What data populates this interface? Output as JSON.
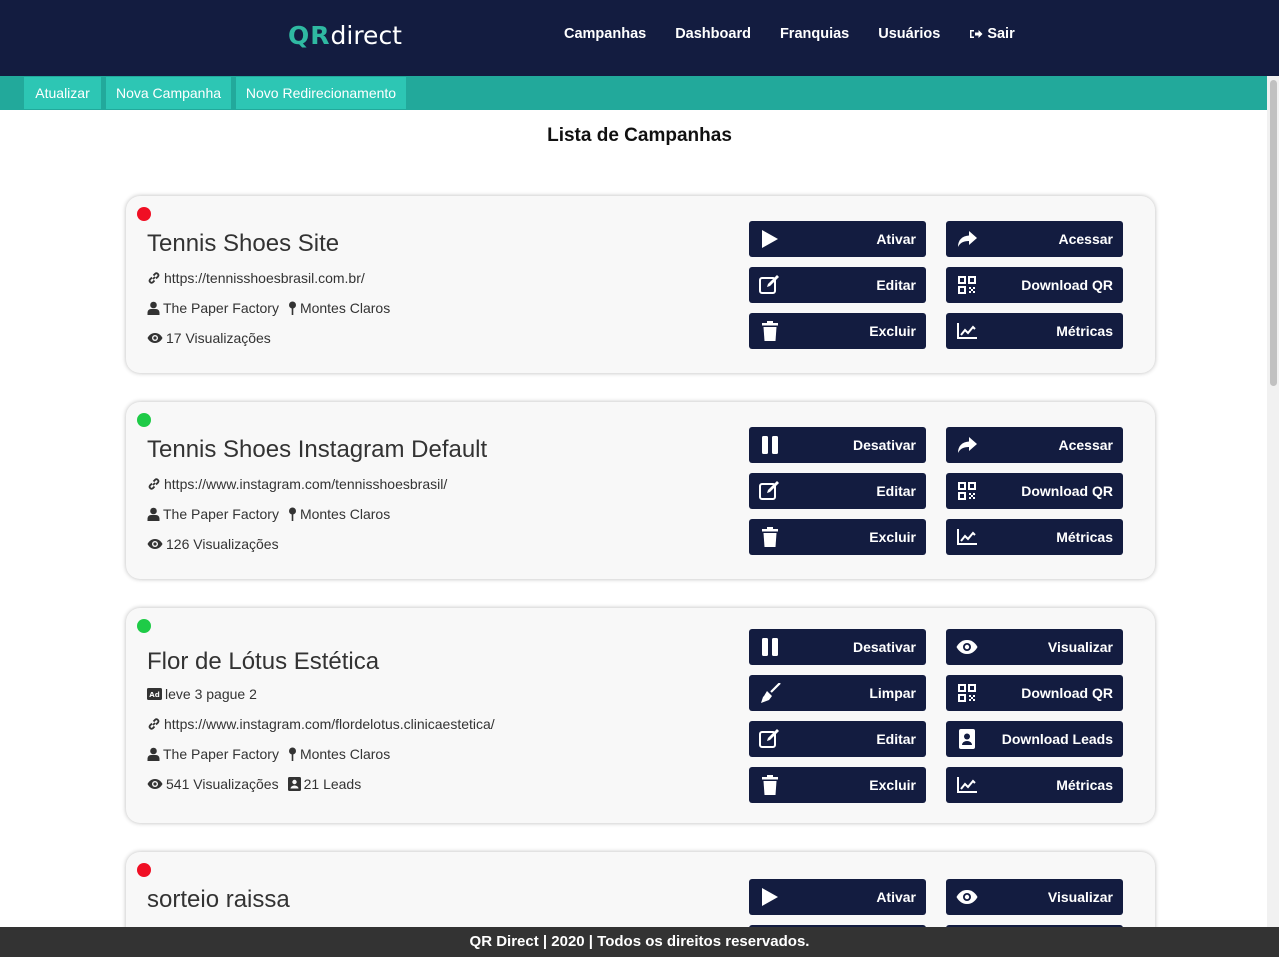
{
  "brand": {
    "logo_qr": "QR",
    "logo_direct": "direct"
  },
  "nav": [
    {
      "label": "Campanhas"
    },
    {
      "label": "Dashboard"
    },
    {
      "label": "Franquias"
    },
    {
      "label": "Usuários"
    },
    {
      "label": "Sair",
      "icon": "sign-out-icon"
    }
  ],
  "toolbar": [
    {
      "label": "Atualizar"
    },
    {
      "label": "Nova Campanha"
    },
    {
      "label": "Novo Redirecionamento"
    }
  ],
  "page_title": "Lista de Campanhas",
  "campaigns": [
    {
      "status": "inactive",
      "status_color": "#f00f24",
      "title": "Tennis Shoes Site",
      "url": "https://tennisshoesbrasil.com.br/",
      "company": "The Paper Factory",
      "city": "Montes Claros",
      "views": "17 Visualizações",
      "buttons": {
        "toggle": "Ativar",
        "access": "Acessar",
        "edit": "Editar",
        "download_qr": "Download QR",
        "delete": "Excluir",
        "metrics": "Métricas"
      }
    },
    {
      "status": "active",
      "status_color": "#1ecb47",
      "title": "Tennis Shoes Instagram Default",
      "url": "https://www.instagram.com/tennisshoesbrasil/",
      "company": "The Paper Factory",
      "city": "Montes Claros",
      "views": "126 Visualizações",
      "buttons": {
        "toggle": "Desativar",
        "access": "Acessar",
        "edit": "Editar",
        "download_qr": "Download QR",
        "delete": "Excluir",
        "metrics": "Métricas"
      }
    },
    {
      "status": "active",
      "status_color": "#1ecb47",
      "title": "Flor de Lótus Estética",
      "promo": "leve 3 pague 2",
      "url": "https://www.instagram.com/flordelotus.clinicaestetica/",
      "company": "The Paper Factory",
      "city": "Montes Claros",
      "views": "541 Visualizações",
      "leads": "21 Leads",
      "buttons": {
        "toggle": "Desativar",
        "view": "Visualizar",
        "clean": "Limpar",
        "download_qr": "Download QR",
        "edit": "Editar",
        "download_leads": "Download Leads",
        "delete": "Excluir",
        "metrics": "Métricas"
      }
    },
    {
      "status": "inactive",
      "status_color": "#f00f24",
      "title": "sorteio raissa",
      "buttons": {
        "toggle": "Ativar",
        "view": "Visualizar"
      }
    }
  ],
  "footer": "QR Direct | 2020 | Todos os direitos reservados.",
  "colors": {
    "navbar": "#131c40",
    "toolbar": "#22a99b",
    "toolbar_button": "#2dc6b4",
    "action_button": "#131c40",
    "footer": "#333333"
  }
}
